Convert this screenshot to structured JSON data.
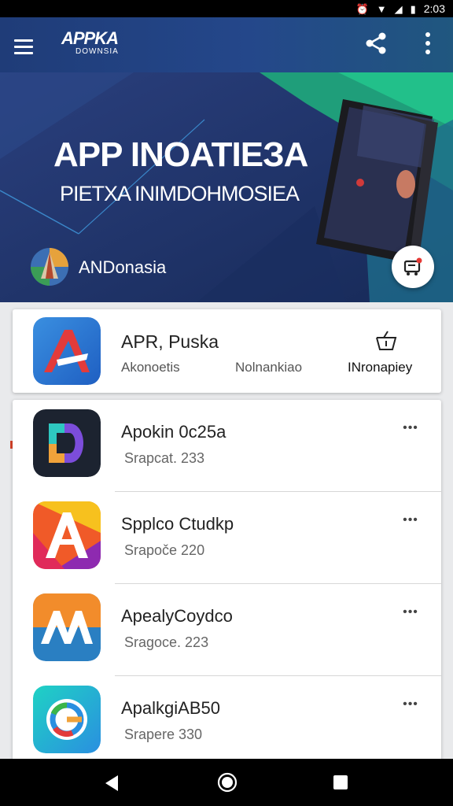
{
  "status_bar": {
    "time": "2:03"
  },
  "app_bar": {
    "logo_main": "APPKA",
    "logo_sub": "DOWNSIA"
  },
  "hero": {
    "title": "APP INOATIEЗA",
    "subtitle": "PIETXA INIMDOHMOSIEA",
    "brand": "ANDonasia"
  },
  "featured": {
    "title": "APR, Puska",
    "col_a": "Akonoetis",
    "col_b": "Nolnankiao",
    "col_c": "INronapiey"
  },
  "apps": [
    {
      "title": "Apokin 0c25a",
      "subtitle": "Srapcat. 233"
    },
    {
      "title": "Spplco Ctudkp",
      "subtitle": "Srapoče 220"
    },
    {
      "title": "ApealyCoydco",
      "subtitle": "Sragoce. 223"
    },
    {
      "title": "ApalkgiAB50",
      "subtitle": "Srapere 330"
    }
  ],
  "icons": {
    "menu": "hamburger-icon",
    "share": "share-icon",
    "more": "more-vert-icon",
    "fab": "cart-icon",
    "featured_action": "basket-icon",
    "row_more": "more-horiz-icon",
    "nav_back": "back-triangle-icon",
    "nav_home": "home-circle-icon",
    "nav_recent": "recents-square-icon"
  },
  "colors": {
    "appbar": "#1f3c78",
    "hero_bg": "#1d3568",
    "hero_accent": "#1fb57a",
    "surface": "#ffffff"
  }
}
